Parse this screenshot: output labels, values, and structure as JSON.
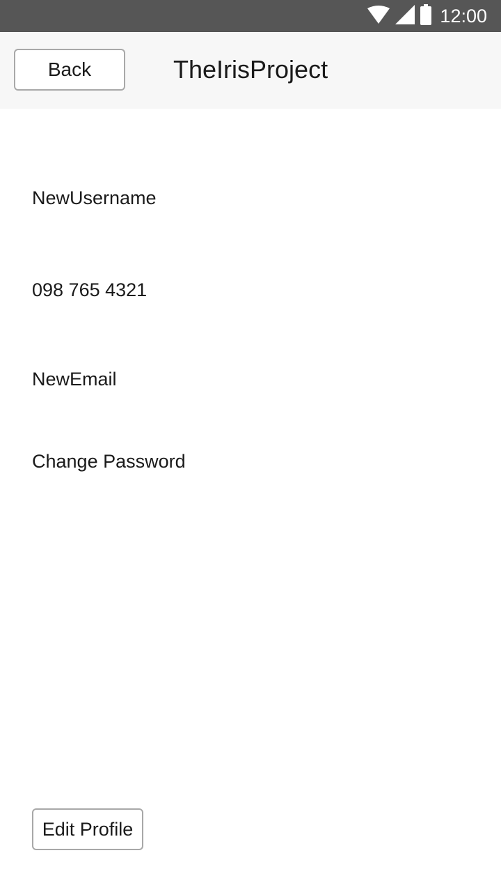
{
  "status_bar": {
    "time": "12:00",
    "icons": [
      "wifi-icon",
      "cellular-signal-icon",
      "battery-icon"
    ]
  },
  "header": {
    "back_label": "Back",
    "title": "TheIrisProject"
  },
  "profile": {
    "username": "NewUsername",
    "phone": "098 765 4321",
    "email": "NewEmail",
    "change_password": "Change Password"
  },
  "actions": {
    "edit_profile_label": "Edit Profile"
  },
  "colors": {
    "status_bar_bg": "#565656",
    "header_bg": "#f7f7f7",
    "button_border": "#a8a8a8",
    "text": "#1a1a1a"
  }
}
